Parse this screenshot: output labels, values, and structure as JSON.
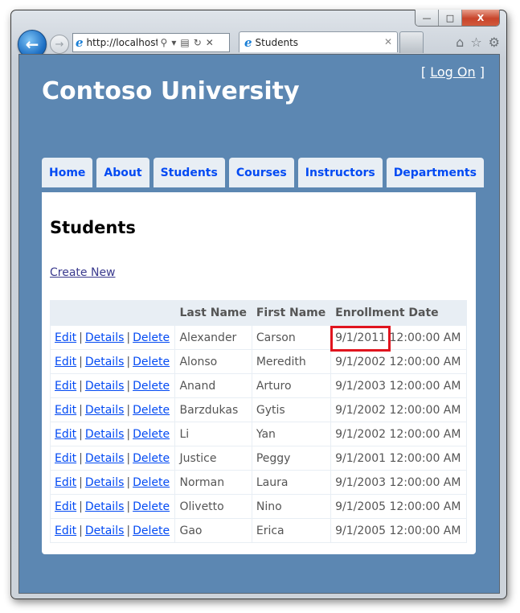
{
  "browser": {
    "address_url": "http://localhost:",
    "tab_title": "Students",
    "window_controls": {
      "minimize": "—",
      "maximize": "□",
      "close": "X"
    }
  },
  "site": {
    "title": "Contoso University",
    "logon_prefix": "[",
    "logon_label": "Log On",
    "logon_suffix": "]"
  },
  "menu": [
    {
      "label": "Home"
    },
    {
      "label": "About"
    },
    {
      "label": "Students"
    },
    {
      "label": "Courses"
    },
    {
      "label": "Instructors"
    },
    {
      "label": "Departments"
    }
  ],
  "page": {
    "heading": "Students",
    "create_new": "Create New"
  },
  "table": {
    "headers": [
      "",
      "Last Name",
      "First Name",
      "Enrollment Date"
    ],
    "actions": {
      "edit": "Edit",
      "details": "Details",
      "delete": "Delete",
      "separator": "|"
    },
    "rows": [
      {
        "last": "Alexander",
        "first": "Carson",
        "date": "9/1/2011",
        "time": "12:00:00 AM"
      },
      {
        "last": "Alonso",
        "first": "Meredith",
        "date": "9/1/2002",
        "time": "12:00:00 AM"
      },
      {
        "last": "Anand",
        "first": "Arturo",
        "date": "9/1/2003",
        "time": "12:00:00 AM"
      },
      {
        "last": "Barzdukas",
        "first": "Gytis",
        "date": "9/1/2002",
        "time": "12:00:00 AM"
      },
      {
        "last": "Li",
        "first": "Yan",
        "date": "9/1/2002",
        "time": "12:00:00 AM"
      },
      {
        "last": "Justice",
        "first": "Peggy",
        "date": "9/1/2001",
        "time": "12:00:00 AM"
      },
      {
        "last": "Norman",
        "first": "Laura",
        "date": "9/1/2003",
        "time": "12:00:00 AM"
      },
      {
        "last": "Olivetto",
        "first": "Nino",
        "date": "9/1/2005",
        "time": "12:00:00 AM"
      },
      {
        "last": "Gao",
        "first": "Erica",
        "date": "9/1/2005",
        "time": "12:00:00 AM"
      }
    ]
  },
  "annotation": {
    "highlighted_value": "9/1/2011",
    "color": "#e0141e"
  },
  "colors": {
    "page_bg": "#5c87b2",
    "menu_text": "#034af3",
    "menu_bg": "#e8eef4"
  }
}
